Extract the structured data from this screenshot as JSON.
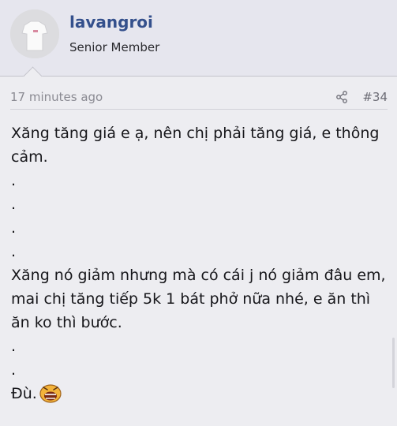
{
  "post": {
    "author": {
      "username": "lavangroi",
      "title": "Senior Member"
    },
    "timestamp": "17 minutes ago",
    "post_number": "#34",
    "message_lines": [
      "Xăng tăng giá e ạ, nên chị phải tăng giá, e thông cảm.",
      ".",
      ".",
      ".",
      ".",
      "Xăng nó giảm nhưng mà có cái j nó giảm đâu em, mai chị tăng tiếp 5k 1 bát phở nữa nhé, e ăn thì ăn ko thì bước.",
      ".",
      "."
    ],
    "final_line": "Đù."
  },
  "icons": {
    "share": "share-icon",
    "emoji": "angry-emoji-icon"
  },
  "colors": {
    "username": "#34508c",
    "background": "#ededf1",
    "header_background": "#e6e6ee",
    "muted_text": "#8a8a92"
  }
}
